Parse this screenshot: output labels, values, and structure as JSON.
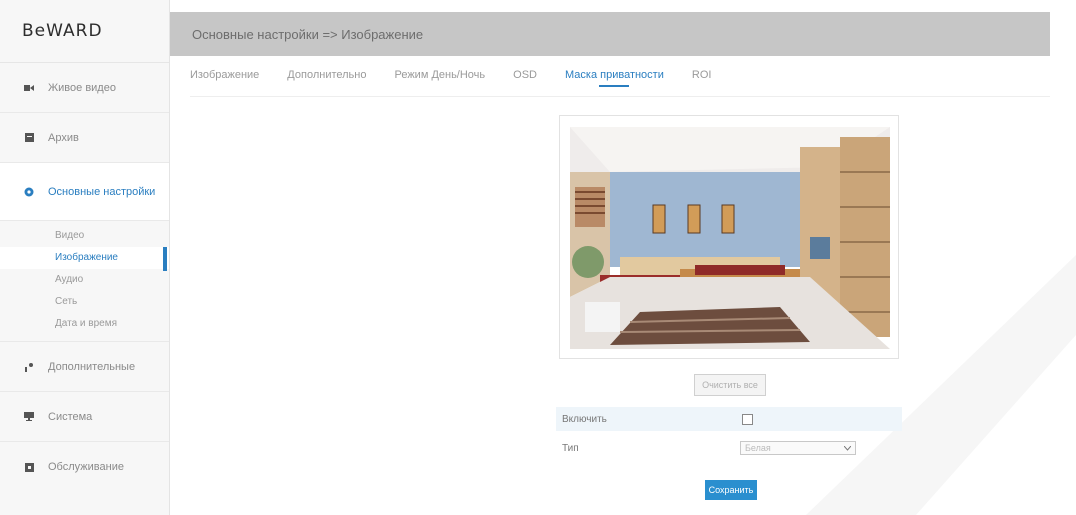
{
  "logo": "BeWARD",
  "header": {
    "title": "Основные настройки => Изображение"
  },
  "sidebar": {
    "items": [
      {
        "label": "Живое видео",
        "icon": "camera-icon"
      },
      {
        "label": "Архив",
        "icon": "archive-icon"
      },
      {
        "label": "Основные настройки",
        "icon": "settings-icon",
        "active": true
      },
      {
        "label": "Дополнительные",
        "icon": "tools-icon"
      },
      {
        "label": "Система",
        "icon": "monitor-icon"
      },
      {
        "label": "Обслуживание",
        "icon": "maintenance-icon"
      }
    ],
    "subitems": [
      {
        "label": "Видео"
      },
      {
        "label": "Изображение",
        "active": true
      },
      {
        "label": "Аудио"
      },
      {
        "label": "Сеть"
      },
      {
        "label": "Дата и время"
      }
    ]
  },
  "tabs": [
    {
      "label": "Изображение"
    },
    {
      "label": "Дополнительно"
    },
    {
      "label": "Режим День/Ночь"
    },
    {
      "label": "OSD"
    },
    {
      "label": "Маска приватности",
      "active": true
    },
    {
      "label": "ROI"
    }
  ],
  "privacy": {
    "clear_label": "Очистить все",
    "enable_label": "Включить",
    "type_label": "Тип",
    "type_value": "Белая",
    "save_label": "Сохранить"
  },
  "colors": {
    "accent": "#2a7ec0",
    "header_bg": "#c6c6c6"
  }
}
